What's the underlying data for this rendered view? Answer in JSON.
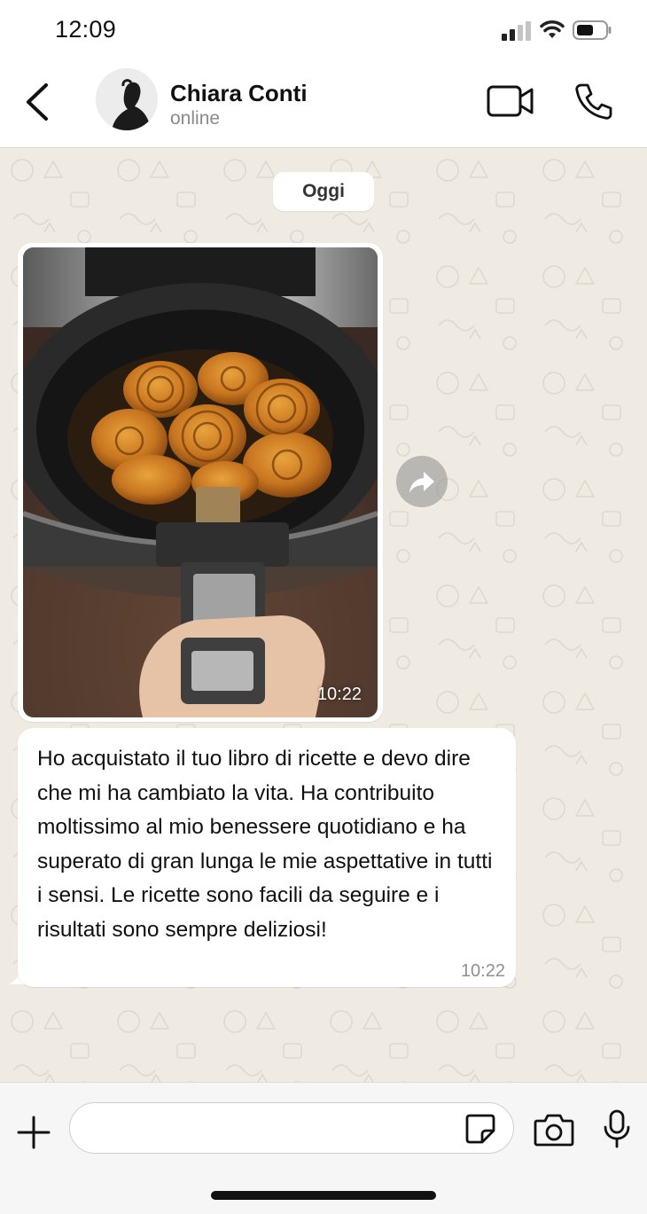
{
  "status_bar": {
    "time": "12:09"
  },
  "header": {
    "contact_name": "Chiara Conti",
    "contact_status": "online",
    "icons": [
      "back-chevron-icon",
      "avatar",
      "video-camera-icon",
      "phone-icon"
    ]
  },
  "chat": {
    "date_separator": "Oggi",
    "messages": [
      {
        "type": "image",
        "image_description_icon": "photo-air-fryer-cinnamon-rolls",
        "time": "10:22"
      },
      {
        "type": "text",
        "text": "Ho acquistato il tuo libro di ricette e devo dire che mi ha cambiato la vita. Ha contribuito moltissimo al mio benessere quotidiano e ha superato di gran lunga le mie aspettative in tutti i sensi. Le ricette sono facili da seguire e i risultati sono sempre deliziosi!",
        "time": "10:22"
      }
    ]
  },
  "composer": {
    "input_value": "",
    "icons": [
      "plus-icon",
      "sticker-icon",
      "camera-icon",
      "microphone-icon"
    ]
  },
  "colors": {
    "chat_background": "#efeae2",
    "bubble": "#ffffff",
    "secondary_text": "#8a8a8a"
  }
}
